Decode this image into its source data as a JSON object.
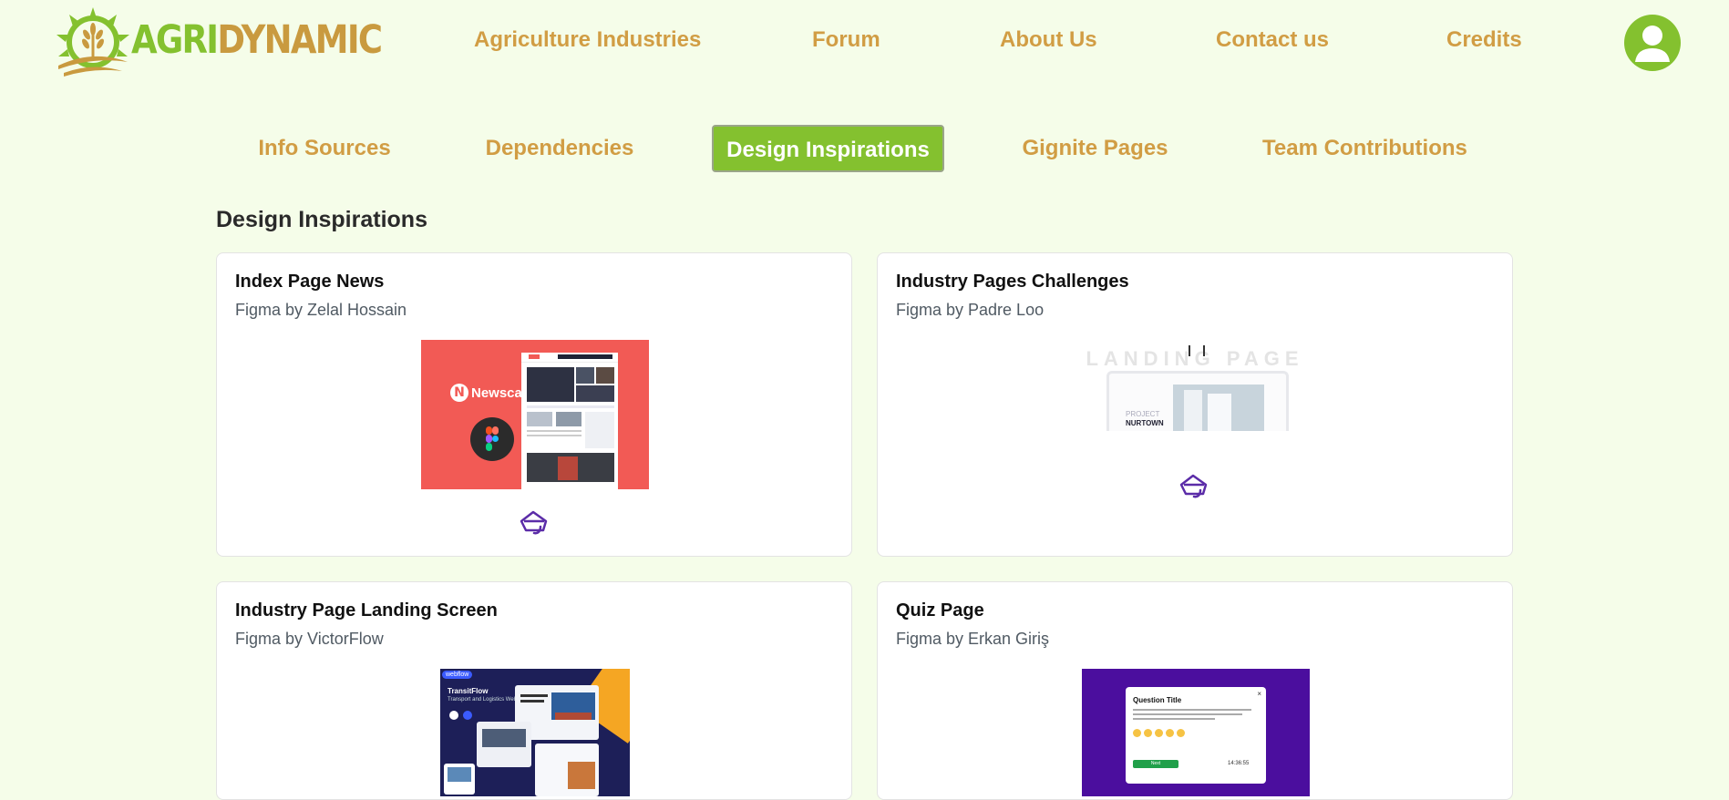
{
  "brand": {
    "part1": "AGRI",
    "part2": "DYNAMIC"
  },
  "nav": [
    {
      "label": "Agriculture Industries"
    },
    {
      "label": "Forum"
    },
    {
      "label": "About Us"
    },
    {
      "label": "Contact us"
    },
    {
      "label": "Credits"
    }
  ],
  "tabs": [
    {
      "label": "Info Sources"
    },
    {
      "label": "Dependencies"
    },
    {
      "label": "Design Inspirations",
      "active": true
    },
    {
      "label": "Gignite Pages"
    },
    {
      "label": "Team Contributions"
    }
  ],
  "section": {
    "title": "Design Inspirations"
  },
  "cards": [
    {
      "title": "Index Page News",
      "subtitle": "Figma by Zelal Hossain",
      "thumb": {
        "brand": "Newscast"
      }
    },
    {
      "title": "Industry Pages Challenges",
      "subtitle": "Figma by Padre Loo",
      "thumb": {
        "heading": "LANDING PAGE",
        "project_label": "PROJECT",
        "project_name": "NURTOWN"
      }
    },
    {
      "title": "Industry Page Landing Screen",
      "subtitle": "Figma by VictorFlow",
      "thumb": {
        "badge": "webflow",
        "brand": "TransitFlow",
        "tagline": "Transport and Logistics Webflow Template"
      }
    },
    {
      "title": "Quiz Page",
      "subtitle": "Figma by Erkan Giriş",
      "thumb": {
        "question_title": "Question Title",
        "button": "Next",
        "timer": "14:36:55"
      }
    }
  ],
  "colors": {
    "background": "#f5fde9",
    "accent_green": "#84c12f",
    "accent_gold": "#d19d44"
  },
  "icons": {
    "open_link": "figma-link-icon",
    "profile": "user-icon"
  }
}
